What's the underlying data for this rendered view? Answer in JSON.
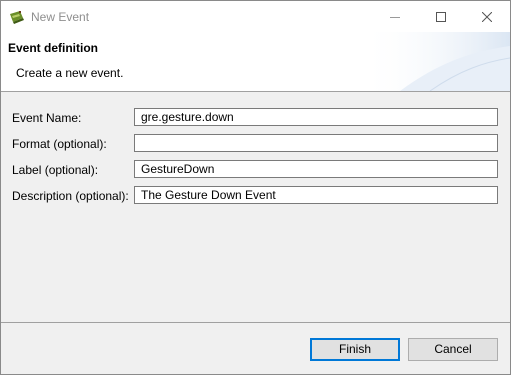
{
  "window": {
    "title": "New Event"
  },
  "header": {
    "title": "Event definition",
    "description": "Create a new event."
  },
  "form": {
    "event_name": {
      "label": "Event Name:",
      "value": "gre.gesture.down"
    },
    "format": {
      "label": "Format (optional):",
      "value": ""
    },
    "label": {
      "label": "Label (optional):",
      "value": "GestureDown"
    },
    "description": {
      "label": "Description (optional):",
      "value": "The Gesture Down Event"
    }
  },
  "buttons": {
    "finish_label": "Finish",
    "cancel_label": "Cancel"
  },
  "colors": {
    "default_button_border": "#0078d7",
    "dialog_background": "#f0f0f0",
    "title_text": "#8f8f8f"
  }
}
